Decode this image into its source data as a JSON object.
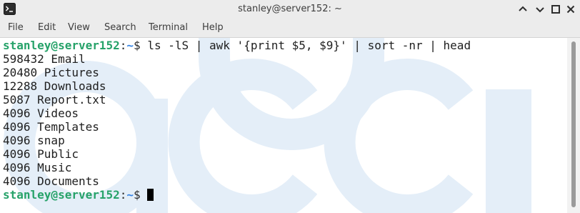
{
  "window": {
    "title": "stanley@server152: ~",
    "app_icon": "terminal-icon",
    "controls": [
      "minimize-icon",
      "maximize-icon",
      "close-icon"
    ]
  },
  "menu": {
    "items": [
      "File",
      "Edit",
      "View",
      "Search",
      "Terminal",
      "Help"
    ]
  },
  "prompt": {
    "user_host": "stanley@server152",
    "separator": ":",
    "path": "~",
    "symbol": "$"
  },
  "command": "ls -lS | awk '{print $5, $9}' | sort -nr | head",
  "output": [
    "598432 Email",
    "20480 Pictures",
    "12288 Downloads",
    "5087 Report.txt",
    "4096 Videos",
    "4096 Templates",
    "4096 snap",
    "4096 Public",
    "4096 Music",
    "4096 Documents"
  ],
  "colors": {
    "prompt_user": "#26a269",
    "prompt_path": "#3584e4",
    "watermark": "#e4eef8"
  }
}
